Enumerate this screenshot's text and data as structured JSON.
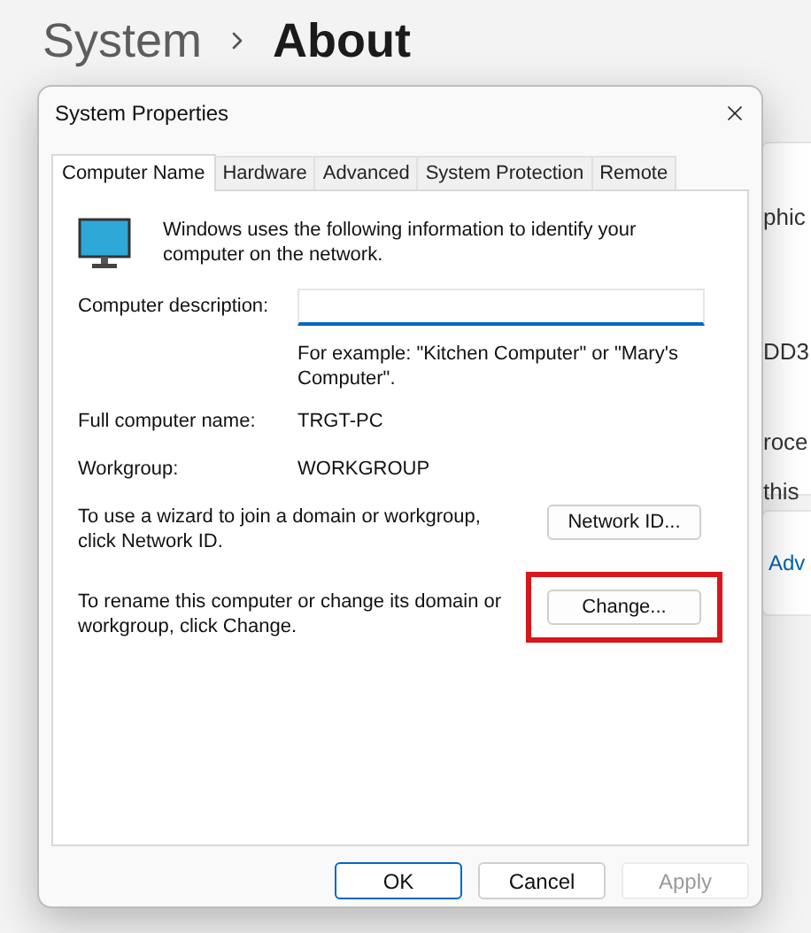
{
  "breadcrumb": [
    {
      "text": "System",
      "current": false
    },
    {
      "text": "About",
      "current": true
    }
  ],
  "background_text": [
    "phic",
    "DD3",
    "roce",
    "this"
  ],
  "background_link": "Adv",
  "dialog": {
    "title": "System Properties",
    "tabs": [
      {
        "label": "Computer Name",
        "selected": true
      },
      {
        "label": "Hardware",
        "selected": false
      },
      {
        "label": "Advanced",
        "selected": false
      },
      {
        "label": "System Protection",
        "selected": false
      },
      {
        "label": "Remote",
        "selected": false
      }
    ],
    "intro": "Windows uses the following information to identify your computer on the network.",
    "description_label": "Computer description:",
    "description_hint": "For example: \"Kitchen Computer\" or \"Mary's Computer\".",
    "fields": [
      {
        "label": "Full computer name:",
        "value": "TRGT-PC"
      },
      {
        "label": "Workgroup:",
        "value": "WORKGROUP"
      }
    ],
    "actions": [
      {
        "text": "To use a wizard to join a domain or workgroup, click Network ID.",
        "button": "Network ID...",
        "highlighted": false
      },
      {
        "text": "To rename this computer or change its domain or workgroup, click Change.",
        "button": "Change...",
        "highlighted": true
      }
    ],
    "buttons": [
      {
        "label": "OK",
        "default": true,
        "disabled": false
      },
      {
        "label": "Cancel",
        "default": false,
        "disabled": false
      },
      {
        "label": "Apply",
        "default": false,
        "disabled": true
      }
    ]
  }
}
